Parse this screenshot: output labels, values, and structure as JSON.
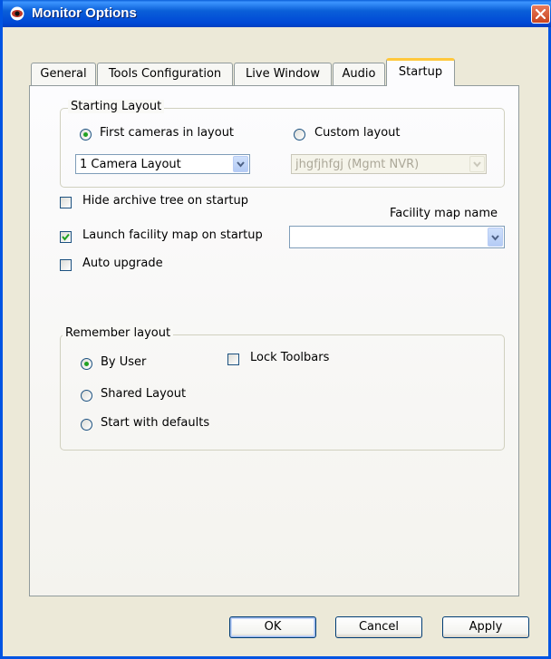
{
  "window": {
    "title": "Monitor Options"
  },
  "tabs": [
    {
      "label": "General"
    },
    {
      "label": "Tools Configuration"
    },
    {
      "label": "Live Window"
    },
    {
      "label": "Audio"
    },
    {
      "label": "Startup",
      "active": true
    }
  ],
  "starting_layout": {
    "legend": "Starting Layout",
    "first_cameras_label": "First cameras in layout",
    "first_cameras_selected": true,
    "custom_layout_label": "Custom layout",
    "custom_layout_selected": false,
    "layout_combo_value": "1 Camera Layout",
    "custom_combo_value": "jhgfjhfgj (Mgmt NVR)"
  },
  "options": {
    "hide_archive_label": "Hide archive tree on startup",
    "hide_archive_checked": false,
    "launch_facility_label": "Launch facility map on startup",
    "launch_facility_checked": true,
    "auto_upgrade_label": "Auto upgrade",
    "auto_upgrade_checked": false,
    "facility_map_name_label": "Facility map name",
    "facility_map_value": ""
  },
  "remember_layout": {
    "legend": "Remember layout",
    "by_user_label": "By User",
    "shared_layout_label": "Shared Layout",
    "start_defaults_label": "Start with defaults",
    "selected": "By User",
    "lock_toolbars_label": "Lock Toolbars",
    "lock_toolbars_checked": false
  },
  "buttons": {
    "ok": "OK",
    "cancel": "Cancel",
    "apply": "Apply"
  },
  "colors": {
    "titlebar": "#0054e3",
    "close_button": "#c94520",
    "active_tab_accent": "#ffc83c",
    "check_mark": "#21a121"
  }
}
